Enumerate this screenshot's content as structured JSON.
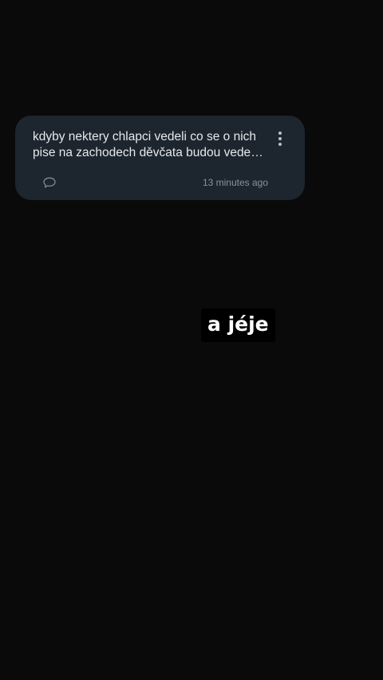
{
  "post": {
    "text": "kdyby nektery chlapci vedeli co se o nich pise na zachodech děvčata budou vedet nejspis by se za to styděli",
    "time": "13 minutes ago",
    "more_icon": "more-vertical-icon",
    "comment_icon": "speech-bubble-icon"
  },
  "caption": {
    "text": "a jéje"
  },
  "colors": {
    "background": "#0a0a0a",
    "card": "#1d252e",
    "text": "#e6e9ec",
    "muted": "#8a939b"
  }
}
